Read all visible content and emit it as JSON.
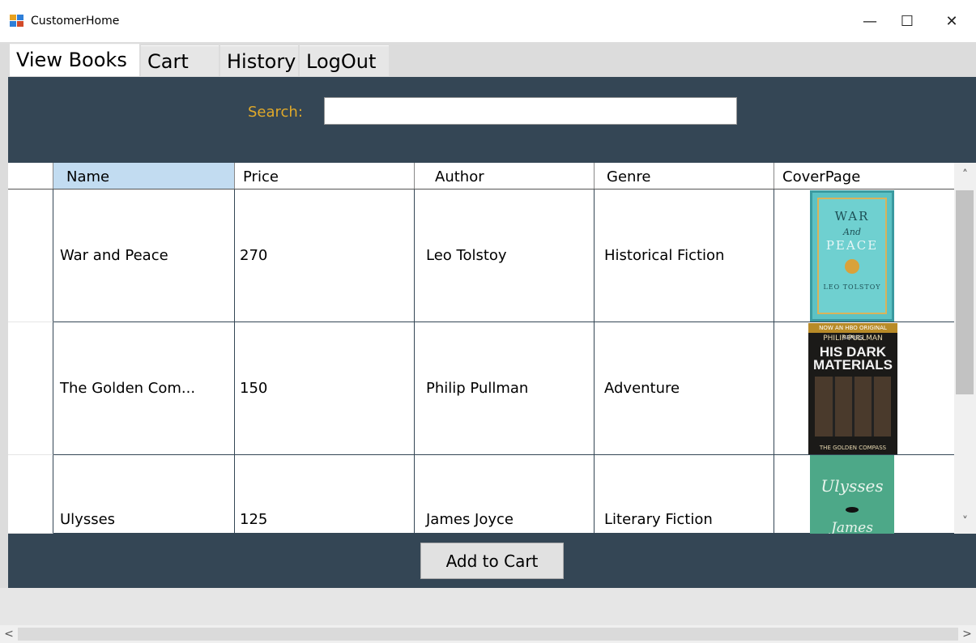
{
  "window": {
    "title": "CustomerHome",
    "minimize": "—",
    "maximize": "☐",
    "close": "✕"
  },
  "tabs": [
    {
      "label": "View Books",
      "active": true
    },
    {
      "label": "Cart",
      "active": false
    },
    {
      "label": "History",
      "active": false
    },
    {
      "label": "LogOut",
      "active": false
    }
  ],
  "search": {
    "label": "Search:",
    "value": "",
    "placeholder": ""
  },
  "grid": {
    "columns": [
      "Name",
      "Price",
      "Author",
      "Genre",
      "CoverPage"
    ],
    "rows": [
      {
        "name": "War and Peace",
        "price": "270",
        "author": "Leo Tolstoy",
        "genre": "Historical Fiction"
      },
      {
        "name": "The Golden Com...",
        "price": "150",
        "author": "Philip Pullman",
        "genre": "Adventure"
      },
      {
        "name": "Ulysses",
        "price": "125",
        "author": "James Joyce",
        "genre": "Literary Fiction"
      }
    ],
    "covers": {
      "war": {
        "line1": "WAR",
        "line2": "And",
        "line3": "PEACE",
        "line4": "LEO TOLSTOY"
      },
      "hdm": {
        "strip": "NOW AN HBO ORIGINAL SERIES",
        "author": "PHILIP PULLMAN",
        "title": "HIS DARK MATERIALS",
        "sub": "THE GOLDEN COMPASS"
      },
      "uly": {
        "line1": "Ulysses",
        "line2": "James"
      }
    }
  },
  "actions": {
    "add_to_cart": "Add to Cart"
  },
  "scroll": {
    "up": "˄",
    "down": "˅",
    "left": "<",
    "right": ">"
  },
  "colors": {
    "panel": "#344655",
    "search_label": "#e0a92a",
    "selected_header": "#c2dcf1"
  }
}
